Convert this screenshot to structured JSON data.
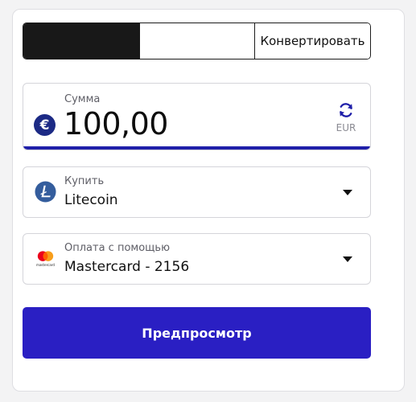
{
  "tabs": {
    "buy_label": "",
    "sell_label": "",
    "convert_label": "Конвертировать"
  },
  "amount": {
    "label": "Сумма",
    "value": "100,00",
    "currency_symbol": "€",
    "swap_currency": "EUR",
    "swap_icon": "refresh-icon"
  },
  "buy": {
    "label": "Купить",
    "value": "Litecoin",
    "icon": "litecoin-icon"
  },
  "payment": {
    "label": "Оплата с помощью",
    "value": "Mastercard - 2156",
    "icon": "mastercard-icon",
    "icon_text": "mastercard"
  },
  "preview_button": {
    "label": "Предпросмотр"
  },
  "colors": {
    "accent": "#2a1fc3",
    "underline": "#1f1fa9",
    "euro_badge": "#1c2a85",
    "litecoin": "#345d9d",
    "mastercard_red": "#eb001b",
    "mastercard_yellow": "#f79e1b",
    "mastercard_orange": "#ff5f00"
  }
}
